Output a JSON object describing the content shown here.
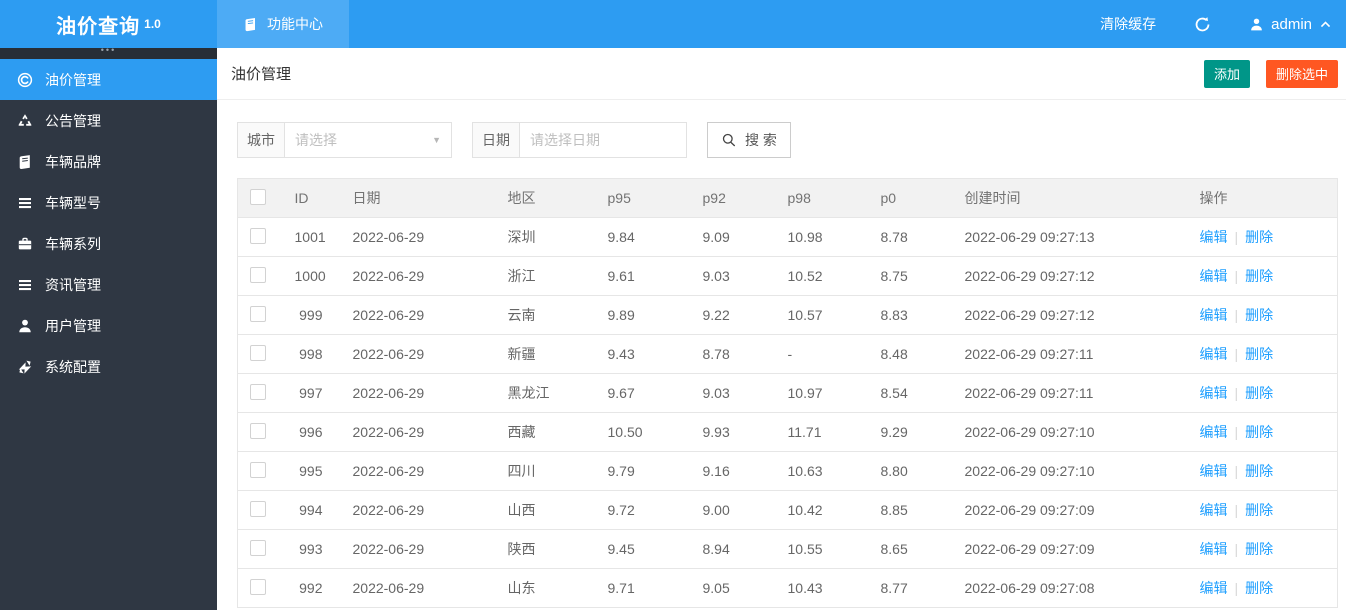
{
  "app": {
    "title": "油价查询",
    "version": "1.0"
  },
  "topbar": {
    "tabs": [
      {
        "label": "功能中心"
      }
    ],
    "clear_cache_label": "清除缓存",
    "username": "admin"
  },
  "sidebar": {
    "collapse_dots": "•••",
    "items": [
      {
        "label": "油价管理",
        "icon": "oil-price-icon",
        "active": true
      },
      {
        "label": "公告管理",
        "icon": "recycle-icon",
        "active": false
      },
      {
        "label": "车辆品牌",
        "icon": "book-icon",
        "active": false
      },
      {
        "label": "车辆型号",
        "icon": "list-icon",
        "active": false
      },
      {
        "label": "车辆系列",
        "icon": "briefcase-icon",
        "active": false
      },
      {
        "label": "资讯管理",
        "icon": "list-icon",
        "active": false
      },
      {
        "label": "用户管理",
        "icon": "user-icon",
        "active": false
      },
      {
        "label": "系统配置",
        "icon": "config-icon",
        "active": false
      }
    ]
  },
  "page": {
    "title": "油价管理",
    "add_button": "添加",
    "delete_selected_button": "删除选中"
  },
  "filters": {
    "city_label": "城市",
    "city_placeholder": "请选择",
    "date_label": "日期",
    "date_placeholder": "请选择日期",
    "search_button": "搜 索"
  },
  "table": {
    "columns": [
      "ID",
      "日期",
      "地区",
      "p95",
      "p92",
      "p98",
      "p0",
      "创建时间",
      "操作"
    ],
    "edit_label": "编辑",
    "delete_label": "删除",
    "ops_separator": "|",
    "rows": [
      {
        "id": "1001",
        "date": "2022-06-29",
        "region": "深圳",
        "p95": "9.84",
        "p92": "9.09",
        "p98": "10.98",
        "p0": "8.78",
        "created": "2022-06-29 09:27:13"
      },
      {
        "id": "1000",
        "date": "2022-06-29",
        "region": "浙江",
        "p95": "9.61",
        "p92": "9.03",
        "p98": "10.52",
        "p0": "8.75",
        "created": "2022-06-29 09:27:12"
      },
      {
        "id": "999",
        "date": "2022-06-29",
        "region": "云南",
        "p95": "9.89",
        "p92": "9.22",
        "p98": "10.57",
        "p0": "8.83",
        "created": "2022-06-29 09:27:12"
      },
      {
        "id": "998",
        "date": "2022-06-29",
        "region": "新疆",
        "p95": "9.43",
        "p92": "8.78",
        "p98": "-",
        "p0": "8.48",
        "created": "2022-06-29 09:27:11"
      },
      {
        "id": "997",
        "date": "2022-06-29",
        "region": "黑龙江",
        "p95": "9.67",
        "p92": "9.03",
        "p98": "10.97",
        "p0": "8.54",
        "created": "2022-06-29 09:27:11"
      },
      {
        "id": "996",
        "date": "2022-06-29",
        "region": "西藏",
        "p95": "10.50",
        "p92": "9.93",
        "p98": "11.71",
        "p0": "9.29",
        "created": "2022-06-29 09:27:10"
      },
      {
        "id": "995",
        "date": "2022-06-29",
        "region": "四川",
        "p95": "9.79",
        "p92": "9.16",
        "p98": "10.63",
        "p0": "8.80",
        "created": "2022-06-29 09:27:10"
      },
      {
        "id": "994",
        "date": "2022-06-29",
        "region": "山西",
        "p95": "9.72",
        "p92": "9.00",
        "p98": "10.42",
        "p0": "8.85",
        "created": "2022-06-29 09:27:09"
      },
      {
        "id": "993",
        "date": "2022-06-29",
        "region": "陕西",
        "p95": "9.45",
        "p92": "8.94",
        "p98": "10.55",
        "p0": "8.65",
        "created": "2022-06-29 09:27:09"
      },
      {
        "id": "992",
        "date": "2022-06-29",
        "region": "山东",
        "p95": "9.71",
        "p92": "9.05",
        "p98": "10.43",
        "p0": "8.77",
        "created": "2022-06-29 09:27:08"
      }
    ]
  },
  "colors": {
    "header_blue": "#2d9cf2",
    "tab_blue": "#4dabf5",
    "sidebar_bg": "#2f3743",
    "active_blue": "#2d9cf2",
    "add_green": "#009688",
    "delete_red": "#FF5722",
    "link_blue": "#1E9FFF",
    "table_header_bg": "#f2f2f2"
  }
}
